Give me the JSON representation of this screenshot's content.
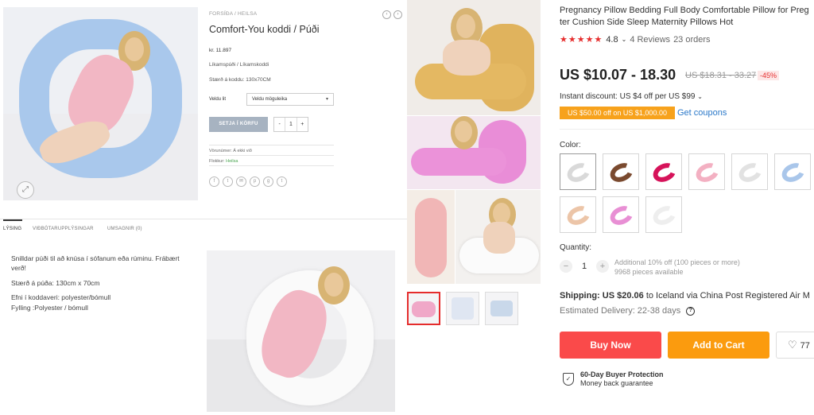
{
  "store": {
    "breadcrumb": "FORSÍÐA / HEILSA",
    "title": "Comfort-You koddi / Púði",
    "price": "kr. 11.897",
    "categories": "Líkamspúði / Líkamskoddi",
    "size": "Stærð á koddu: 130x70CM",
    "select_label": "Veldu lit",
    "select_value": "Veldu möguleika",
    "add_to_cart": "SETJA Í KÖRFU",
    "qty_minus": "-",
    "qty_value": "1",
    "qty_plus": "+",
    "sku": "Vörunúmer: Á ekki við",
    "category": "Flokkur:",
    "category_link": "Heilsa",
    "tabs": [
      "LÝSING",
      "VIÐBÓTARUPPLÝSINGAR",
      "UMSAGNIR (0)"
    ],
    "description": [
      "Snilldar púði til að knúsa í sófanum eða rúminu. Frábært",
      "verð!",
      "Stærð á púða: 130cm x 70cm",
      "Efni í koddaveri: polyester/bómull",
      "Fylling :Polyester / bómull"
    ]
  },
  "market": {
    "title_line1": "Pregnancy Pillow Bedding Full Body Comfortable Pillow for Preg",
    "title_line2": "ter Cushion Side Sleep Maternity Pillows Hot",
    "stars": "★★★★★",
    "rating": "4.8",
    "reviews": "4 Reviews",
    "orders": "23 orders",
    "price": "US $10.07 - 18.30",
    "old_price": "US $18.31 - 33.27",
    "discount": "-45%",
    "instant_discount": "Instant discount: US $4 off per US $99",
    "coupon": "US $50.00 off on US $1,000.00",
    "get_coupons": "Get coupons",
    "color_label": "Color:",
    "quantity_label": "Quantity:",
    "quantity": "1",
    "qty_note1": "Additional 10% off (100 pieces or more)",
    "qty_note2": "9968 pieces available",
    "shipping_bold": "Shipping: US $20.06",
    "shipping_rest": "to Iceland via China Post Registered Air M",
    "delivery": "Estimated Delivery: 22-38 days",
    "buy_now": "Buy Now",
    "add_to_cart": "Add to Cart",
    "wishlist_count": "77",
    "protection_title": "60-Day Buyer Protection",
    "protection_sub": "Money back guarantee",
    "swatch_colors": [
      "#d9d9d9",
      "#7a4a2f",
      "#d6135a",
      "#f3b0c2",
      "#e2e2e2",
      "#a9c6ea",
      "#ecc5a8",
      "#e88fd4",
      "#eeeeee"
    ]
  }
}
